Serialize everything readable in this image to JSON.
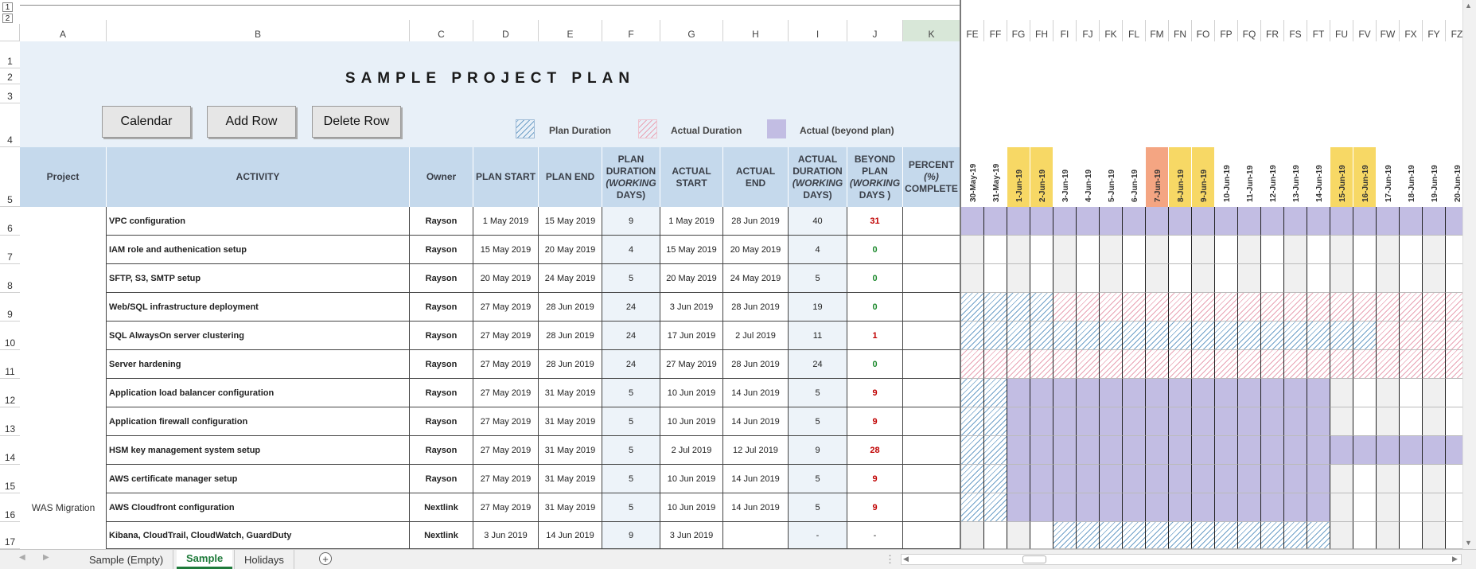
{
  "title": "SAMPLE PROJECT PLAN",
  "buttons": {
    "calendar": "Calendar",
    "add_row": "Add Row",
    "delete_row": "Delete Row"
  },
  "legend": {
    "plan": "Plan Duration",
    "actual": "Actual Duration",
    "beyond": "Actual (beyond plan)"
  },
  "colors": {
    "header_bg": "#c5d9ec",
    "banner_bg": "#e8f0f8",
    "weekend": "#f7d865",
    "holiday": "#f4a582",
    "beyond": "#c2bde3",
    "plan_hatch": "#6fa0c8",
    "actual_hatch": "#e9a3b4",
    "red": "#c00000",
    "green": "#1e8a2e",
    "active_tab": "#1e7a3a"
  },
  "outline_levels": [
    "1",
    "2"
  ],
  "column_letters": [
    "A",
    "B",
    "C",
    "D",
    "E",
    "F",
    "G",
    "H",
    "I",
    "J",
    "K"
  ],
  "gantt_column_letters": [
    "FE",
    "FF",
    "FG",
    "FH",
    "FI",
    "FJ",
    "FK",
    "FL",
    "FM",
    "FN",
    "FO",
    "FP",
    "FQ",
    "FR",
    "FS",
    "FT",
    "FU",
    "FV",
    "FW",
    "FX",
    "FY",
    "FZ"
  ],
  "row_numbers": [
    "1",
    "2",
    "3",
    "4",
    "5",
    "6",
    "7",
    "8",
    "9",
    "10",
    "11",
    "12",
    "13",
    "14",
    "15",
    "16",
    "17"
  ],
  "headers": {
    "project": "Project",
    "activity": "ACTIVITY",
    "owner": "Owner",
    "plan_start": "PLAN START",
    "plan_end": "PLAN END",
    "plan_duration": [
      "PLAN",
      "DURATION",
      "(WORKING",
      "DAYS)"
    ],
    "actual_start": [
      "ACTUAL",
      "START"
    ],
    "actual_end": "ACTUAL END",
    "actual_duration": [
      "ACTUAL",
      "DURATION",
      "(WORKING",
      "DAYS)"
    ],
    "beyond_plan": [
      "BEYOND",
      "PLAN",
      "(WORKING",
      "DAYS )"
    ],
    "percent_complete": [
      "PERCENT",
      "(%)",
      "COMPLETE"
    ]
  },
  "project_name": "WAS Migration",
  "dates": [
    {
      "label": "30-May-19",
      "kind": "normal"
    },
    {
      "label": "31-May-19",
      "kind": "normal"
    },
    {
      "label": "1-Jun-19",
      "kind": "weekend"
    },
    {
      "label": "2-Jun-19",
      "kind": "weekend"
    },
    {
      "label": "3-Jun-19",
      "kind": "normal"
    },
    {
      "label": "4-Jun-19",
      "kind": "normal"
    },
    {
      "label": "5-Jun-19",
      "kind": "normal"
    },
    {
      "label": "6-Jun-19",
      "kind": "normal"
    },
    {
      "label": "7-Jun-19",
      "kind": "holiday"
    },
    {
      "label": "8-Jun-19",
      "kind": "weekend"
    },
    {
      "label": "9-Jun-19",
      "kind": "weekend"
    },
    {
      "label": "10-Jun-19",
      "kind": "normal"
    },
    {
      "label": "11-Jun-19",
      "kind": "normal"
    },
    {
      "label": "12-Jun-19",
      "kind": "normal"
    },
    {
      "label": "13-Jun-19",
      "kind": "normal"
    },
    {
      "label": "14-Jun-19",
      "kind": "normal"
    },
    {
      "label": "15-Jun-19",
      "kind": "weekend"
    },
    {
      "label": "16-Jun-19",
      "kind": "weekend"
    },
    {
      "label": "17-Jun-19",
      "kind": "normal"
    },
    {
      "label": "18-Jun-19",
      "kind": "normal"
    },
    {
      "label": "19-Jun-19",
      "kind": "normal"
    },
    {
      "label": "20-Jun-19",
      "kind": "normal"
    }
  ],
  "tasks": [
    {
      "row": "6",
      "activity": "VPC configuration",
      "owner": "Rayson",
      "plan_start": "1 May 2019",
      "plan_end": "15 May 2019",
      "plan_duration": "9",
      "actual_start": "1 May 2019",
      "actual_end": "28 Jun 2019",
      "actual_duration": "40",
      "beyond": "31",
      "beyond_status": "red",
      "percent": "",
      "gantt": [
        "beyond",
        "beyond",
        "beyond",
        "beyond",
        "beyond",
        "beyond",
        "beyond",
        "beyond",
        "beyond",
        "beyond",
        "beyond",
        "beyond",
        "beyond",
        "beyond",
        "beyond",
        "beyond",
        "beyond",
        "beyond",
        "beyond",
        "beyond",
        "beyond",
        "beyond"
      ]
    },
    {
      "row": "7",
      "activity": "IAM role and authenication setup",
      "owner": "Rayson",
      "plan_start": "15 May 2019",
      "plan_end": "20 May 2019",
      "plan_duration": "4",
      "actual_start": "15 May 2019",
      "actual_end": "20 May 2019",
      "actual_duration": "4",
      "beyond": "0",
      "beyond_status": "green",
      "percent": "",
      "gantt": [
        "",
        "",
        "",
        "",
        "",
        "",
        "",
        "",
        "",
        "",
        "",
        "",
        "",
        "",
        "",
        "",
        "",
        "",
        "",
        "",
        "",
        ""
      ]
    },
    {
      "row": "8",
      "activity": "SFTP, S3, SMTP setup",
      "owner": "Rayson",
      "plan_start": "20 May 2019",
      "plan_end": "24 May 2019",
      "plan_duration": "5",
      "actual_start": "20 May 2019",
      "actual_end": "24 May 2019",
      "actual_duration": "5",
      "beyond": "0",
      "beyond_status": "green",
      "percent": "",
      "gantt": [
        "",
        "",
        "",
        "",
        "",
        "",
        "",
        "",
        "",
        "",
        "",
        "",
        "",
        "",
        "",
        "",
        "",
        "",
        "",
        "",
        "",
        ""
      ]
    },
    {
      "row": "9",
      "activity": "Web/SQL infrastructure deployment",
      "owner": "Rayson",
      "plan_start": "27 May 2019",
      "plan_end": "28 Jun 2019",
      "plan_duration": "24",
      "actual_start": "3 Jun 2019",
      "actual_end": "28 Jun 2019",
      "actual_duration": "19",
      "beyond": "0",
      "beyond_status": "green",
      "percent": "",
      "gantt": [
        "plan",
        "plan",
        "plan",
        "plan",
        "actual",
        "actual",
        "actual",
        "actual",
        "actual",
        "actual",
        "actual",
        "actual",
        "actual",
        "actual",
        "actual",
        "actual",
        "actual",
        "actual",
        "actual",
        "actual",
        "actual",
        "actual"
      ]
    },
    {
      "row": "10",
      "activity": "SQL AlwaysOn server clustering",
      "owner": "Rayson",
      "plan_start": "27 May 2019",
      "plan_end": "28 Jun 2019",
      "plan_duration": "24",
      "actual_start": "17 Jun 2019",
      "actual_end": "2 Jul 2019",
      "actual_duration": "11",
      "beyond": "1",
      "beyond_status": "red",
      "percent": "",
      "gantt": [
        "plan",
        "plan",
        "plan",
        "plan",
        "plan",
        "plan",
        "plan",
        "plan",
        "plan",
        "plan",
        "plan",
        "plan",
        "plan",
        "plan",
        "plan",
        "plan",
        "plan",
        "plan",
        "actual",
        "actual",
        "actual",
        "actual"
      ]
    },
    {
      "row": "11",
      "activity": "Server hardening",
      "owner": "Rayson",
      "plan_start": "27 May 2019",
      "plan_end": "28 Jun 2019",
      "plan_duration": "24",
      "actual_start": "27 May 2019",
      "actual_end": "28 Jun 2019",
      "actual_duration": "24",
      "beyond": "0",
      "beyond_status": "green",
      "percent": "",
      "gantt": [
        "actual",
        "actual",
        "actual",
        "actual",
        "actual",
        "actual",
        "actual",
        "actual",
        "actual",
        "actual",
        "actual",
        "actual",
        "actual",
        "actual",
        "actual",
        "actual",
        "actual",
        "actual",
        "actual",
        "actual",
        "actual",
        "actual"
      ]
    },
    {
      "row": "12",
      "activity": "Application load balancer configuration",
      "owner": "Rayson",
      "plan_start": "27 May 2019",
      "plan_end": "31 May 2019",
      "plan_duration": "5",
      "actual_start": "10 Jun 2019",
      "actual_end": "14 Jun 2019",
      "actual_duration": "5",
      "beyond": "9",
      "beyond_status": "red",
      "percent": "",
      "gantt": [
        "plan",
        "plan",
        "beyond",
        "beyond",
        "beyond",
        "beyond",
        "beyond",
        "beyond",
        "beyond",
        "beyond",
        "beyond",
        "beyond",
        "beyond",
        "beyond",
        "beyond",
        "beyond",
        "",
        "",
        "",
        "",
        "",
        ""
      ]
    },
    {
      "row": "13",
      "activity": "Application firewall configuration",
      "owner": "Rayson",
      "plan_start": "27 May 2019",
      "plan_end": "31 May 2019",
      "plan_duration": "5",
      "actual_start": "10 Jun 2019",
      "actual_end": "14 Jun 2019",
      "actual_duration": "5",
      "beyond": "9",
      "beyond_status": "red",
      "percent": "",
      "gantt": [
        "plan",
        "plan",
        "beyond",
        "beyond",
        "beyond",
        "beyond",
        "beyond",
        "beyond",
        "beyond",
        "beyond",
        "beyond",
        "beyond",
        "beyond",
        "beyond",
        "beyond",
        "beyond",
        "",
        "",
        "",
        "",
        "",
        ""
      ]
    },
    {
      "row": "14",
      "activity": "HSM key management system setup",
      "owner": "Rayson",
      "plan_start": "27 May 2019",
      "plan_end": "31 May 2019",
      "plan_duration": "5",
      "actual_start": "2 Jul 2019",
      "actual_end": "12 Jul 2019",
      "actual_duration": "9",
      "beyond": "28",
      "beyond_status": "red",
      "percent": "",
      "gantt": [
        "plan",
        "plan",
        "beyond",
        "beyond",
        "beyond",
        "beyond",
        "beyond",
        "beyond",
        "beyond",
        "beyond",
        "beyond",
        "beyond",
        "beyond",
        "beyond",
        "beyond",
        "beyond",
        "beyond",
        "beyond",
        "beyond",
        "beyond",
        "beyond",
        "beyond"
      ]
    },
    {
      "row": "15",
      "activity": "AWS certificate manager setup",
      "owner": "Rayson",
      "plan_start": "27 May 2019",
      "plan_end": "31 May 2019",
      "plan_duration": "5",
      "actual_start": "10 Jun 2019",
      "actual_end": "14 Jun 2019",
      "actual_duration": "5",
      "beyond": "9",
      "beyond_status": "red",
      "percent": "",
      "gantt": [
        "plan",
        "plan",
        "beyond",
        "beyond",
        "beyond",
        "beyond",
        "beyond",
        "beyond",
        "beyond",
        "beyond",
        "beyond",
        "beyond",
        "beyond",
        "beyond",
        "beyond",
        "beyond",
        "",
        "",
        "",
        "",
        "",
        ""
      ]
    },
    {
      "row": "16",
      "activity": "AWS Cloudfront configuration",
      "owner": "Nextlink",
      "plan_start": "27 May 2019",
      "plan_end": "31 May 2019",
      "plan_duration": "5",
      "actual_start": "10 Jun 2019",
      "actual_end": "14 Jun 2019",
      "actual_duration": "5",
      "beyond": "9",
      "beyond_status": "red",
      "percent": "",
      "gantt": [
        "plan",
        "plan",
        "beyond",
        "beyond",
        "beyond",
        "beyond",
        "beyond",
        "beyond",
        "beyond",
        "beyond",
        "beyond",
        "beyond",
        "beyond",
        "beyond",
        "beyond",
        "beyond",
        "",
        "",
        "",
        "",
        "",
        ""
      ]
    },
    {
      "row": "17",
      "activity": "Kibana, CloudTrail, CloudWatch, GuardDuty",
      "owner": "Nextlink",
      "plan_start": "3 Jun 2019",
      "plan_end": "14 Jun 2019",
      "plan_duration": "9",
      "actual_start": "3 Jun 2019",
      "actual_end": "",
      "actual_duration": "-",
      "beyond": "-",
      "beyond_status": "",
      "percent": "",
      "gantt": [
        "",
        "",
        "",
        "",
        "plan",
        "plan",
        "plan",
        "plan",
        "plan",
        "plan",
        "plan",
        "plan",
        "plan",
        "plan",
        "plan",
        "plan",
        "",
        "",
        "",
        "",
        "",
        ""
      ]
    }
  ],
  "sheet_tabs": [
    {
      "label": "Sample (Empty)",
      "active": false
    },
    {
      "label": "Sample",
      "active": true
    },
    {
      "label": "Holidays",
      "active": false
    }
  ],
  "add_sheet_symbol": "+"
}
